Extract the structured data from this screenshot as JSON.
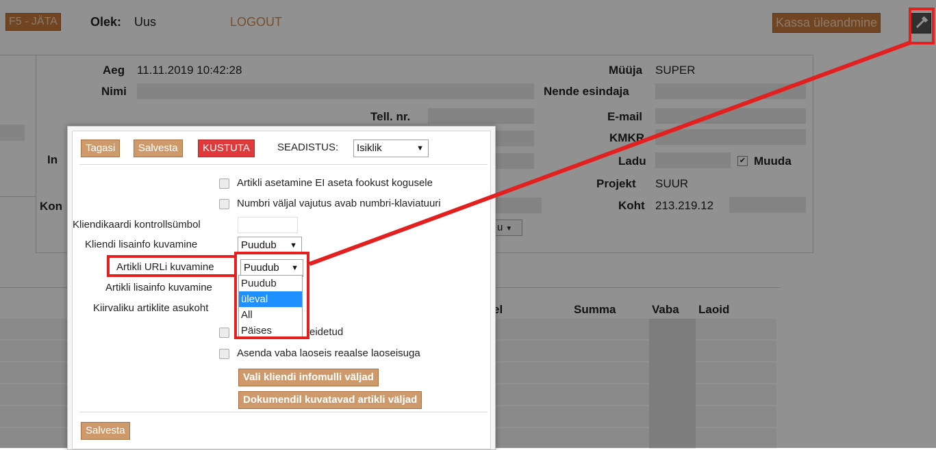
{
  "topbar": {
    "f5_button": "F5 - JÄTA",
    "state_label": "Olek:",
    "state_value": "Uus",
    "logout": "LOGOUT",
    "kassa_button": "Kassa üleandmine"
  },
  "form": {
    "aeg_label": "Aeg",
    "aeg_value": "11.11.2019 10:42:28",
    "nimi_label": "Nimi",
    "tell_label": "Tell. nr.",
    "muuja_label": "Müüja",
    "muuja_value": "SUPER",
    "nende_label": "Nende esindaja",
    "email_label": "E-mail",
    "kmkr_label": "KMKR",
    "ladu_label": "Ladu",
    "muuda_label": "Muuda",
    "projekt_label": "Projekt",
    "projekt_value": "SUUR",
    "koht_label": "Koht",
    "koht_value": "213.219.12",
    "in_label": "In",
    "kon_label": "Kon",
    "partial_select": "u"
  },
  "table": {
    "headers": [
      "el",
      "Summa",
      "Vaba",
      "Laoid"
    ]
  },
  "dialog": {
    "tagasi": "Tagasi",
    "salvesta_top": "Salvesta",
    "kustuta": "KUSTUTA",
    "seadistus_label": "SEADISTUS:",
    "seadistus_value": "Isiklik",
    "opt_fookus": "Artikli asetamine EI aseta fookust kogusele",
    "opt_numbri": "Numbri väljal vajutus avab numbri-klaviatuuri",
    "kontroll_label": "Kliendikaardi kontrollsümbol",
    "kliendi_lisainfo_label": "Kliendi lisainfo kuvamine",
    "kliendi_lisainfo_value": "Puudub",
    "artikli_url_label": "Artikli URLi kuvamine",
    "artikli_url_value": "Puudub",
    "artikli_lisainfo_label": "Artikli lisainfo kuvamine",
    "kiirvaliku_label": "Kiirvaliku artiklite asukoht",
    "opt_peidetud": "eidetud",
    "opt_asenda": "Asenda vaba laoseis reaalse laoseisuga",
    "btn_infomulli": "Vali kliendi infomulli väljad",
    "btn_dokumendil": "Dokumendil kuvatavad artikli väljad",
    "salvesta_bottom": "Salvesta",
    "dropdown_options": [
      "Puudub",
      "üleval",
      "All",
      "Päises"
    ],
    "dropdown_highlighted": "üleval"
  },
  "annotation_color": "#e22020"
}
